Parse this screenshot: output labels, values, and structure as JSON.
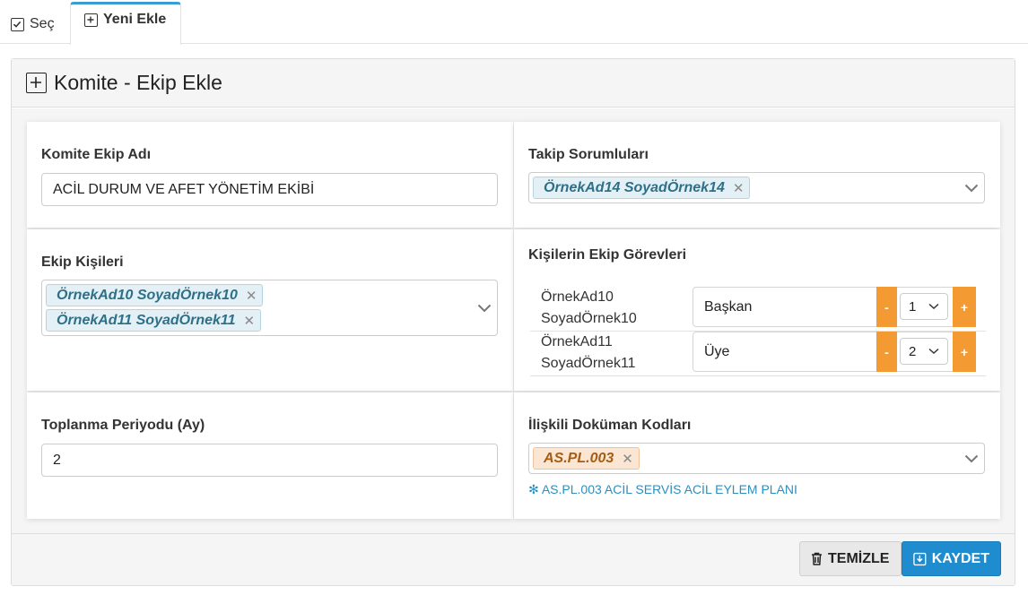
{
  "tabs": [
    {
      "label": "Seç",
      "active": false
    },
    {
      "label": "Yeni Ekle",
      "active": true
    }
  ],
  "panel": {
    "title": "Komite - Ekip Ekle"
  },
  "form": {
    "team_name": {
      "label": "Komite Ekip Adı",
      "value": "ACİL DURUM VE AFET YÖNETİM EKİBİ"
    },
    "followers": {
      "label": "Takip Sorumluları",
      "tags": [
        "ÖrnekAd14 SoyadÖrnek14"
      ]
    },
    "members": {
      "label": "Ekip Kişileri",
      "tags": [
        "ÖrnekAd10 SoyadÖrnek10",
        "ÖrnekAd11 SoyadÖrnek11"
      ]
    },
    "roles": {
      "label": "Kişilerin Ekip Görevleri",
      "rows": [
        {
          "name_line1": "ÖrnekAd10",
          "name_line2": "SoyadÖrnek10",
          "role": "Başkan",
          "order": "1"
        },
        {
          "name_line1": "ÖrnekAd11",
          "name_line2": "SoyadÖrnek11",
          "role": "Üye",
          "order": "2"
        }
      ],
      "minus": "-",
      "plus": "+"
    },
    "period": {
      "label": "Toplanma Periyodu (Ay)",
      "value": "2"
    },
    "documents": {
      "label": "İlişkili Doküman Kodları",
      "tags": [
        "AS.PL.003"
      ],
      "hint": "✻ AS.PL.003 ACİL SERVİS ACİL EYLEM PLANI"
    }
  },
  "footer": {
    "clear_label": "TEMİZLE",
    "save_label": "KAYDET"
  },
  "colors": {
    "accent": "#1f8ccf",
    "orange": "#f39a33",
    "tag_blue_bg": "#e3f1f6",
    "tag_orange_bg": "#fbe6d4"
  }
}
